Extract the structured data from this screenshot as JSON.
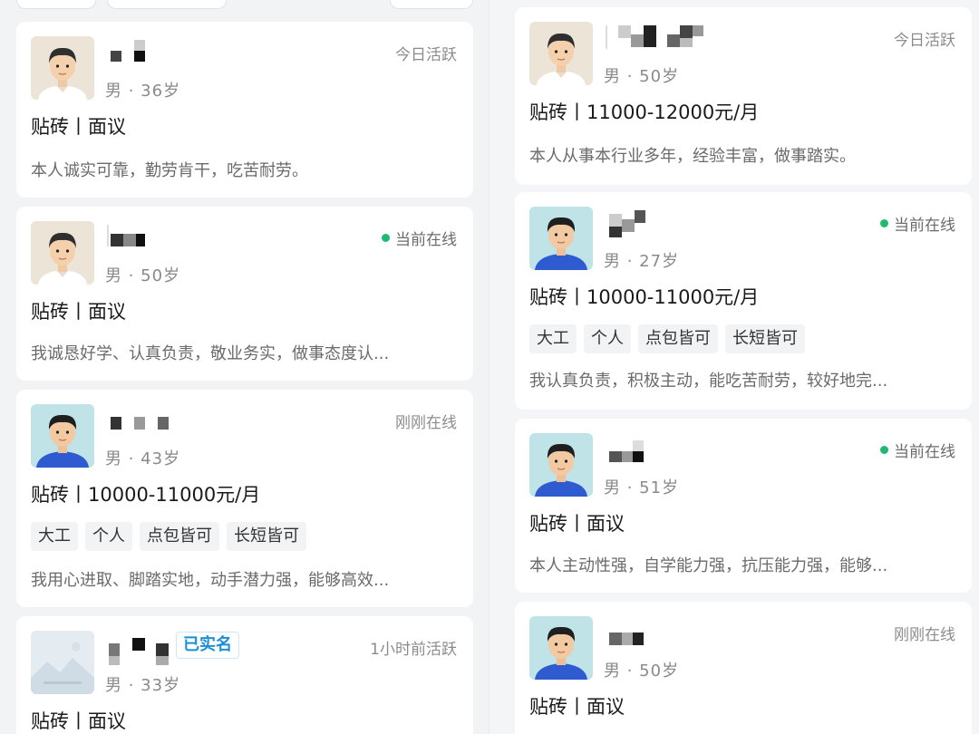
{
  "left_column": {
    "cards": [
      {
        "status": "今日活跃",
        "online": false,
        "meta": "男 · 36岁",
        "title": "贴砖丨面议",
        "tags": [],
        "description": "本人诚实可靠，勤劳肯干，吃苦耐劳。",
        "avatar": "man-avatar-beige",
        "verified_label": ""
      },
      {
        "status": "当前在线",
        "online": true,
        "meta": "男 · 50岁",
        "title": "贴砖丨面议",
        "tags": [],
        "description": "我诚恳好学、认真负责，敬业务实，做事态度认...",
        "avatar": "man-avatar-beige",
        "verified_label": ""
      },
      {
        "status": "刚刚在线",
        "online": false,
        "meta": "男 · 43岁",
        "title": "贴砖丨10000-11000元/月",
        "tags": [
          "大工",
          "个人",
          "点包皆可",
          "长短皆可"
        ],
        "description": "我用心进取、脚踏实地，动手潜力强，能够高效...",
        "avatar": "man-avatar-teal",
        "verified_label": ""
      },
      {
        "status": "1小时前活跃",
        "online": false,
        "meta": "男 · 33岁",
        "title": "贴砖丨面议",
        "tags": [],
        "description": "",
        "avatar": "placeholder-image-icon",
        "verified_label": "已实名"
      }
    ]
  },
  "right_column": {
    "cards": [
      {
        "status": "今日活跃",
        "online": false,
        "meta": "男 · 50岁",
        "title": "贴砖丨11000-12000元/月",
        "tags": [],
        "description": "本人从事本行业多年，经验丰富，做事踏实。",
        "avatar": "man-avatar-beige",
        "verified_label": ""
      },
      {
        "status": "当前在线",
        "online": true,
        "meta": "男 · 27岁",
        "title": "贴砖丨10000-11000元/月",
        "tags": [
          "大工",
          "个人",
          "点包皆可",
          "长短皆可"
        ],
        "description": "我认真负责，积极主动，能吃苦耐劳，较好地完...",
        "avatar": "man-avatar-teal",
        "verified_label": ""
      },
      {
        "status": "当前在线",
        "online": true,
        "meta": "男 · 51岁",
        "title": "贴砖丨面议",
        "tags": [],
        "description": "本人主动性强，自学能力强，抗压能力强，能够...",
        "avatar": "man-avatar-teal",
        "verified_label": ""
      },
      {
        "status": "刚刚在线",
        "online": false,
        "meta": "男 · 50岁",
        "title": "贴砖丨面议",
        "tags": [],
        "description": "",
        "avatar": "man-avatar-teal",
        "verified_label": ""
      }
    ]
  },
  "colors": {
    "online_dot": "#1fba72",
    "verified_text": "#1a8fd6",
    "card_bg": "#ffffff",
    "page_bg": "#f2f3f5"
  }
}
